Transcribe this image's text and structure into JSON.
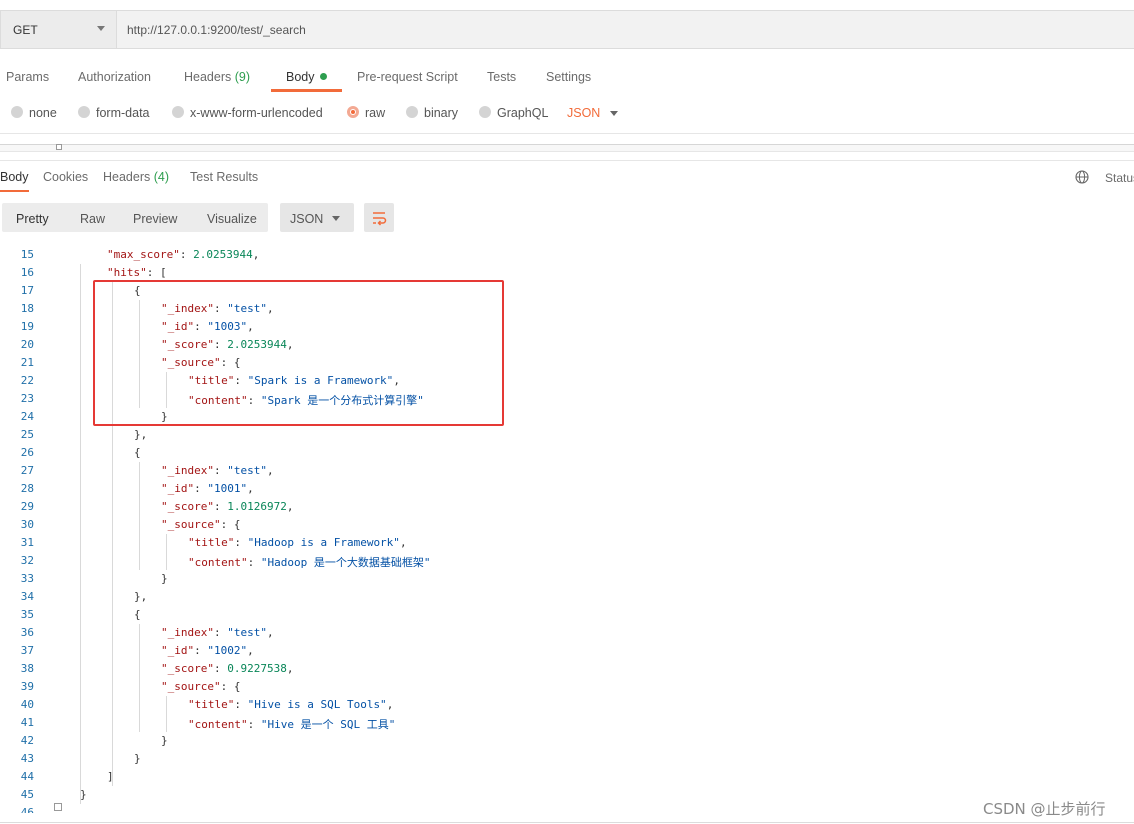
{
  "request": {
    "method": "GET",
    "url": "http://127.0.0.1:9200/test/_search"
  },
  "request_tabs": [
    {
      "label": "Params"
    },
    {
      "label": "Authorization"
    },
    {
      "label": "Headers",
      "count": "(9)"
    },
    {
      "label": "Body",
      "active": true
    },
    {
      "label": "Pre-request Script"
    },
    {
      "label": "Tests"
    },
    {
      "label": "Settings"
    }
  ],
  "body_types": [
    {
      "label": "none"
    },
    {
      "label": "form-data"
    },
    {
      "label": "x-www-form-urlencoded"
    },
    {
      "label": "raw",
      "selected": true
    },
    {
      "label": "binary"
    },
    {
      "label": "GraphQL"
    }
  ],
  "body_format": "JSON",
  "response_tabs": [
    {
      "label": "Body",
      "active": true
    },
    {
      "label": "Cookies"
    },
    {
      "label": "Headers",
      "count": "(4)"
    },
    {
      "label": "Test Results"
    }
  ],
  "status_label": "Status",
  "view_modes": [
    {
      "label": "Pretty",
      "active": true
    },
    {
      "label": "Raw"
    },
    {
      "label": "Preview"
    },
    {
      "label": "Visualize"
    }
  ],
  "response_format": "JSON",
  "code_lines": [
    {
      "n": "15",
      "indent": 2,
      "tokens": [
        [
          "k",
          "\"max_score\""
        ],
        [
          "p",
          ": "
        ],
        [
          "n",
          "2.0253944"
        ],
        [
          "p",
          ","
        ]
      ]
    },
    {
      "n": "16",
      "indent": 2,
      "tokens": [
        [
          "k",
          "\"hits\""
        ],
        [
          "p",
          ": ["
        ]
      ]
    },
    {
      "n": "17",
      "indent": 3,
      "tokens": [
        [
          "p",
          "{"
        ]
      ]
    },
    {
      "n": "18",
      "indent": 4,
      "tokens": [
        [
          "k",
          "\"_index\""
        ],
        [
          "p",
          ": "
        ],
        [
          "s",
          "\"test\""
        ],
        [
          "p",
          ","
        ]
      ]
    },
    {
      "n": "19",
      "indent": 4,
      "tokens": [
        [
          "k",
          "\"_id\""
        ],
        [
          "p",
          ": "
        ],
        [
          "s",
          "\"1003\""
        ],
        [
          "p",
          ","
        ]
      ]
    },
    {
      "n": "20",
      "indent": 4,
      "tokens": [
        [
          "k",
          "\"_score\""
        ],
        [
          "p",
          ": "
        ],
        [
          "n",
          "2.0253944"
        ],
        [
          "p",
          ","
        ]
      ]
    },
    {
      "n": "21",
      "indent": 4,
      "tokens": [
        [
          "k",
          "\"_source\""
        ],
        [
          "p",
          ": {"
        ]
      ]
    },
    {
      "n": "22",
      "indent": 5,
      "tokens": [
        [
          "k",
          "\"title\""
        ],
        [
          "p",
          ": "
        ],
        [
          "s",
          "\"Spark is a Framework\""
        ],
        [
          "p",
          ","
        ]
      ]
    },
    {
      "n": "23",
      "indent": 5,
      "tokens": [
        [
          "k",
          "\"content\""
        ],
        [
          "p",
          ": "
        ],
        [
          "s",
          "\"Spark 是一个分布式计算引擎\""
        ]
      ]
    },
    {
      "n": "24",
      "indent": 4,
      "tokens": [
        [
          "p",
          "}"
        ]
      ]
    },
    {
      "n": "25",
      "indent": 3,
      "tokens": [
        [
          "p",
          "},"
        ]
      ]
    },
    {
      "n": "26",
      "indent": 3,
      "tokens": [
        [
          "p",
          "{"
        ]
      ]
    },
    {
      "n": "27",
      "indent": 4,
      "tokens": [
        [
          "k",
          "\"_index\""
        ],
        [
          "p",
          ": "
        ],
        [
          "s",
          "\"test\""
        ],
        [
          "p",
          ","
        ]
      ]
    },
    {
      "n": "28",
      "indent": 4,
      "tokens": [
        [
          "k",
          "\"_id\""
        ],
        [
          "p",
          ": "
        ],
        [
          "s",
          "\"1001\""
        ],
        [
          "p",
          ","
        ]
      ]
    },
    {
      "n": "29",
      "indent": 4,
      "tokens": [
        [
          "k",
          "\"_score\""
        ],
        [
          "p",
          ": "
        ],
        [
          "n",
          "1.0126972"
        ],
        [
          "p",
          ","
        ]
      ]
    },
    {
      "n": "30",
      "indent": 4,
      "tokens": [
        [
          "k",
          "\"_source\""
        ],
        [
          "p",
          ": {"
        ]
      ]
    },
    {
      "n": "31",
      "indent": 5,
      "tokens": [
        [
          "k",
          "\"title\""
        ],
        [
          "p",
          ": "
        ],
        [
          "s",
          "\"Hadoop is a Framework\""
        ],
        [
          "p",
          ","
        ]
      ]
    },
    {
      "n": "32",
      "indent": 5,
      "tokens": [
        [
          "k",
          "\"content\""
        ],
        [
          "p",
          ": "
        ],
        [
          "s",
          "\"Hadoop 是一个大数据基础框架\""
        ]
      ]
    },
    {
      "n": "33",
      "indent": 4,
      "tokens": [
        [
          "p",
          "}"
        ]
      ]
    },
    {
      "n": "34",
      "indent": 3,
      "tokens": [
        [
          "p",
          "},"
        ]
      ]
    },
    {
      "n": "35",
      "indent": 3,
      "tokens": [
        [
          "p",
          "{"
        ]
      ]
    },
    {
      "n": "36",
      "indent": 4,
      "tokens": [
        [
          "k",
          "\"_index\""
        ],
        [
          "p",
          ": "
        ],
        [
          "s",
          "\"test\""
        ],
        [
          "p",
          ","
        ]
      ]
    },
    {
      "n": "37",
      "indent": 4,
      "tokens": [
        [
          "k",
          "\"_id\""
        ],
        [
          "p",
          ": "
        ],
        [
          "s",
          "\"1002\""
        ],
        [
          "p",
          ","
        ]
      ]
    },
    {
      "n": "38",
      "indent": 4,
      "tokens": [
        [
          "k",
          "\"_score\""
        ],
        [
          "p",
          ": "
        ],
        [
          "n",
          "0.9227538"
        ],
        [
          "p",
          ","
        ]
      ]
    },
    {
      "n": "39",
      "indent": 4,
      "tokens": [
        [
          "k",
          "\"_source\""
        ],
        [
          "p",
          ": {"
        ]
      ]
    },
    {
      "n": "40",
      "indent": 5,
      "tokens": [
        [
          "k",
          "\"title\""
        ],
        [
          "p",
          ": "
        ],
        [
          "s",
          "\"Hive is a SQL Tools\""
        ],
        [
          "p",
          ","
        ]
      ]
    },
    {
      "n": "41",
      "indent": 5,
      "tokens": [
        [
          "k",
          "\"content\""
        ],
        [
          "p",
          ": "
        ],
        [
          "s",
          "\"Hive 是一个 SQL 工具\""
        ]
      ]
    },
    {
      "n": "42",
      "indent": 4,
      "tokens": [
        [
          "p",
          "}"
        ]
      ]
    },
    {
      "n": "43",
      "indent": 3,
      "tokens": [
        [
          "p",
          "}"
        ]
      ]
    },
    {
      "n": "44",
      "indent": 2,
      "tokens": [
        [
          "p",
          "]"
        ]
      ]
    },
    {
      "n": "45",
      "indent": 1,
      "tokens": [
        [
          "p",
          "}"
        ]
      ]
    },
    {
      "n": "46",
      "indent": 0,
      "tokens": []
    }
  ],
  "watermark": "CSDN @止步前行",
  "colors": {
    "accent": "#f26b3a",
    "count_green": "#2e9e4f",
    "json_key": "#a31515",
    "json_string": "#0451a5",
    "json_number": "#098658",
    "line_number": "#1f6fa8",
    "highlight_border": "#e53935"
  }
}
